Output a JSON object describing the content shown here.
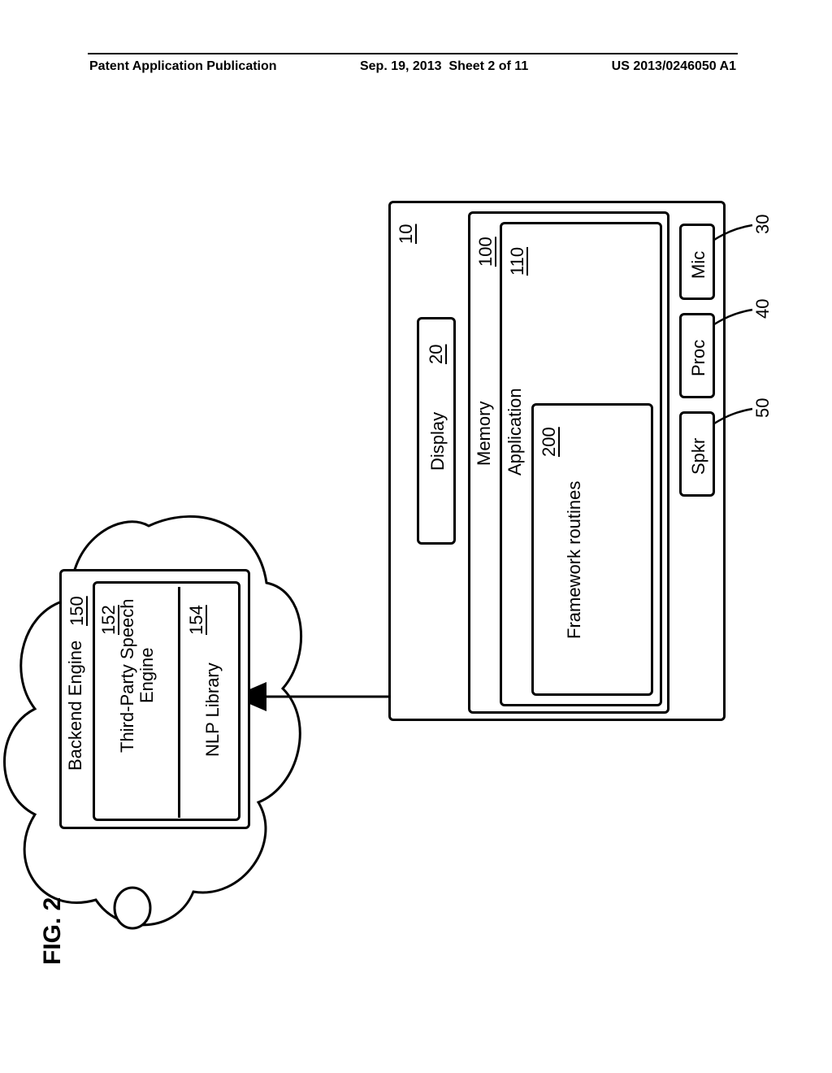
{
  "header": {
    "pub": "Patent Application Publication",
    "date": "Sep. 19, 2013",
    "sheet": "Sheet 2 of 11",
    "docnum": "US 2013/0246050 A1"
  },
  "figure_label": "FIG. 2",
  "device": {
    "ref": "10",
    "display": {
      "ref": "20",
      "label": "Display"
    },
    "mic": {
      "ref": "30",
      "label": "Mic"
    },
    "proc": {
      "ref": "40",
      "label": "Proc"
    },
    "spkr": {
      "ref": "50",
      "label": "Spkr"
    },
    "memory": {
      "ref": "100",
      "label": "Memory"
    },
    "application": {
      "ref": "110",
      "label": "Application"
    },
    "framework": {
      "ref": "200",
      "label": "Framework routines"
    }
  },
  "backend": {
    "ref": "150",
    "label": "Backend Engine",
    "speech": {
      "ref": "152",
      "label": "Third-Party Speech Engine"
    },
    "nlp": {
      "ref": "154",
      "label": "NLP Library"
    }
  }
}
